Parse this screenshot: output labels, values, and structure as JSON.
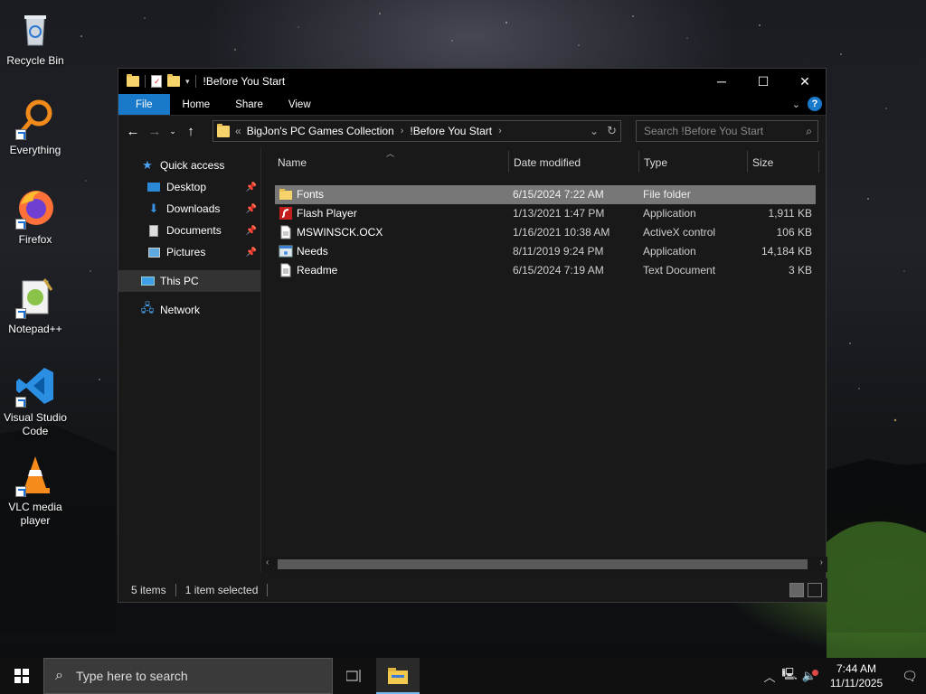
{
  "desktop": {
    "icons": [
      {
        "label": "Recycle Bin"
      },
      {
        "label": "Everything"
      },
      {
        "label": "Firefox"
      },
      {
        "label": "Notepad++"
      },
      {
        "label": "Visual Studio Code"
      },
      {
        "label": "VLC media player"
      }
    ]
  },
  "window": {
    "title": "!Before You Start",
    "ribbon_tabs": [
      "File",
      "Home",
      "Share",
      "View"
    ],
    "address": {
      "prefix": "«",
      "crumbs": [
        "BigJon's PC Games Collection",
        "!Before You Start"
      ]
    },
    "search_placeholder": "Search !Before You Start",
    "nav": {
      "quick_access": "Quick access",
      "items": [
        "Desktop",
        "Downloads",
        "Documents",
        "Pictures"
      ],
      "this_pc": "This PC",
      "network": "Network"
    },
    "columns": {
      "name": "Name",
      "date": "Date modified",
      "type": "Type",
      "size": "Size"
    },
    "files": [
      {
        "name": "Fonts",
        "date": "6/15/2024 7:22 AM",
        "type": "File folder",
        "size": "",
        "icon": "folder-icon",
        "selected": true
      },
      {
        "name": "Flash Player",
        "date": "1/13/2021 1:47 PM",
        "type": "Application",
        "size": "1,911 KB",
        "icon": "flash-player-icon",
        "selected": false
      },
      {
        "name": "MSWINSCK.OCX",
        "date": "1/16/2021 10:38 AM",
        "type": "ActiveX control",
        "size": "106 KB",
        "icon": "activex-file-icon",
        "selected": false
      },
      {
        "name": "Needs",
        "date": "8/11/2019 9:24 PM",
        "type": "Application",
        "size": "14,184 KB",
        "icon": "application-icon",
        "selected": false
      },
      {
        "name": "Readme",
        "date": "6/15/2024 7:19 AM",
        "type": "Text Document",
        "size": "3 KB",
        "icon": "text-document-icon",
        "selected": false
      }
    ],
    "status": {
      "items": "5 items",
      "selected": "1 item selected"
    }
  },
  "taskbar": {
    "search_placeholder": "Type here to search",
    "time": "7:44 AM",
    "date": "11/11/2025"
  },
  "colors": {
    "accent": "#1979ca",
    "selection": "#777777"
  }
}
